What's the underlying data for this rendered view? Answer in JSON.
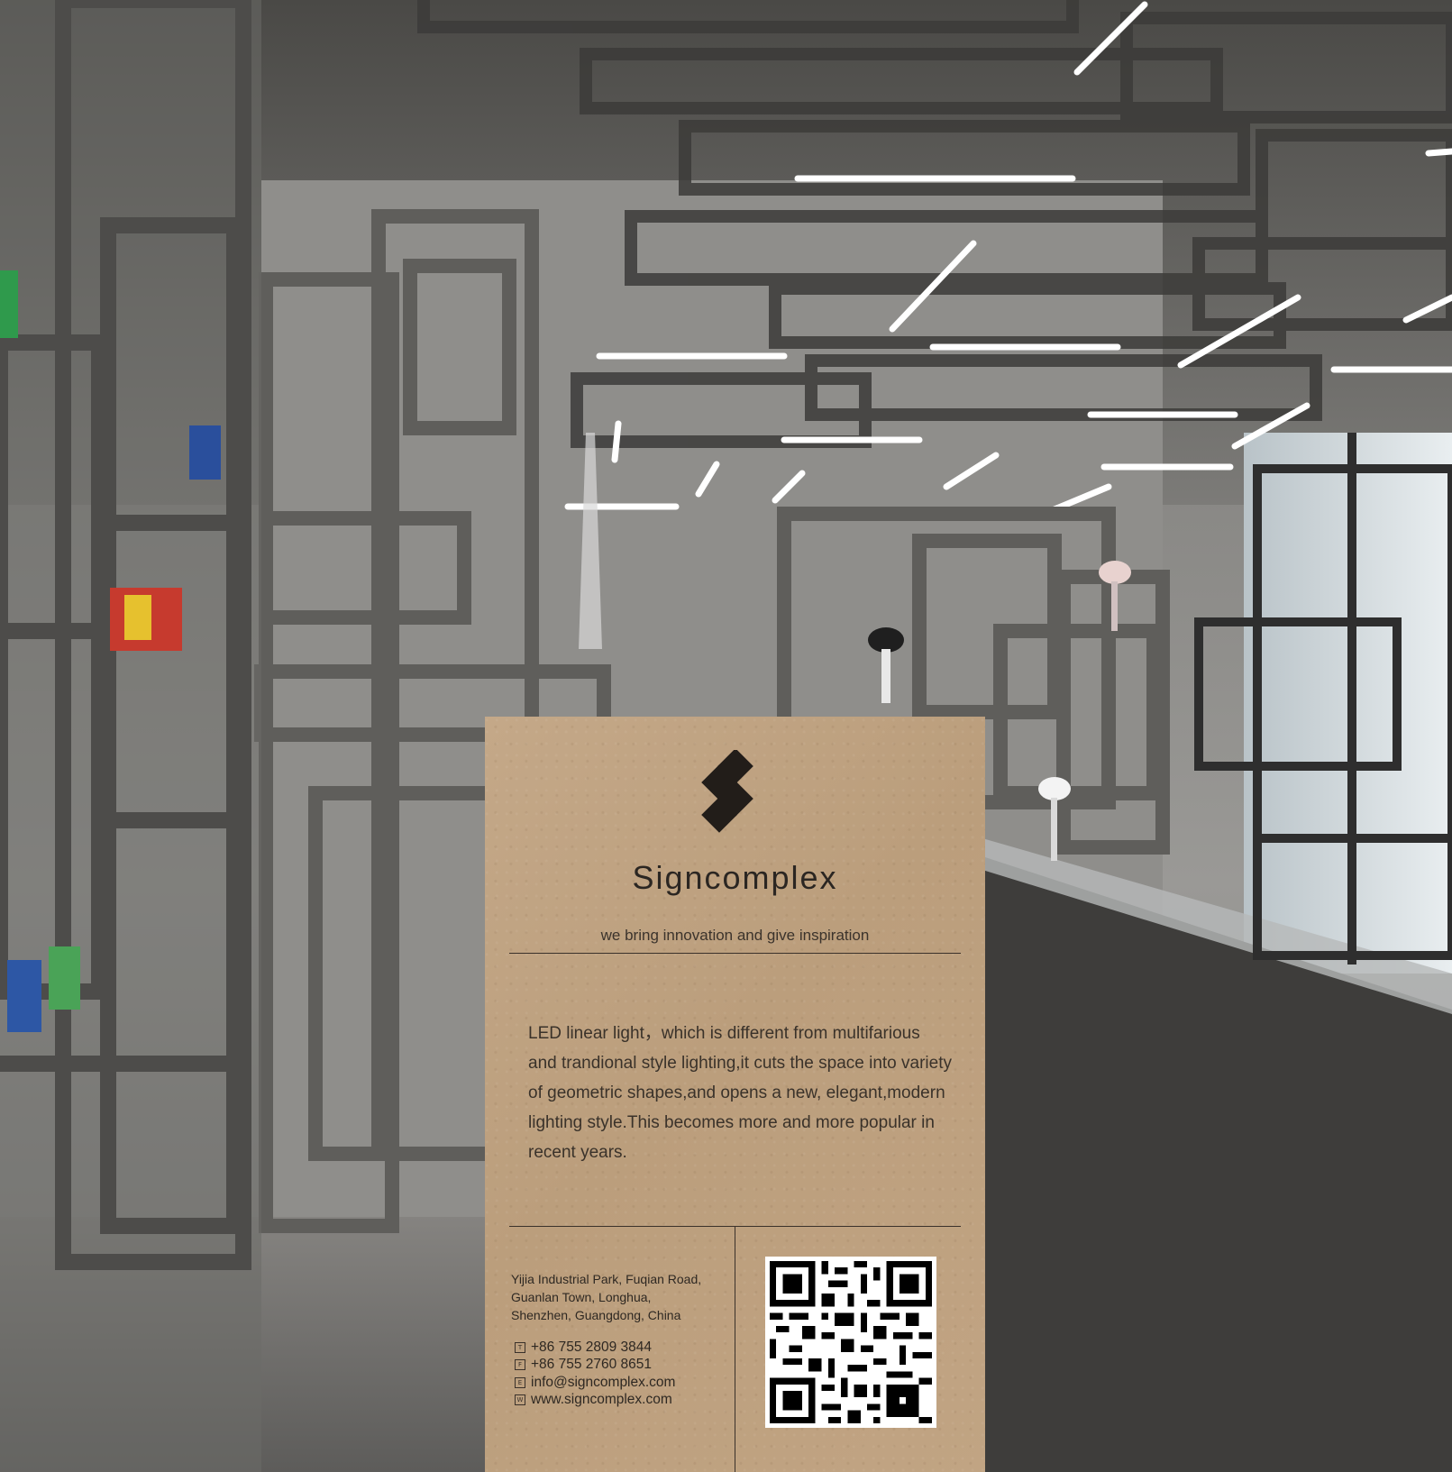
{
  "card": {
    "brand_name": "Signcomplex",
    "tagline": "we bring innovation and give inspiration",
    "description": "LED linear light，which is different from multifarious and trandional style lighting,it cuts the space into variety of geometric shapes,and opens a new, elegant,modern lighting style.This becomes more and more popular in recent years.",
    "address": "Yijia Industrial Park, Fuqian Road,\nGuanlan Town,  Longhua,\nShenzhen, Guangdong, China",
    "contacts": [
      {
        "icon": "T",
        "icon_name": "phone-icon",
        "text": "+86 755 2809 3844"
      },
      {
        "icon": "F",
        "icon_name": "fax-icon",
        "text": "+86 755 2760 8651"
      },
      {
        "icon": "E",
        "icon_name": "email-icon",
        "text": "info@signcomplex.com"
      },
      {
        "icon": "W",
        "icon_name": "website-icon",
        "text": "www.signcomplex.com"
      }
    ],
    "colors": {
      "kraft": "#c1a483",
      "ink": "#2b2622"
    }
  },
  "background": {
    "description_icon": "showroom-photo"
  }
}
